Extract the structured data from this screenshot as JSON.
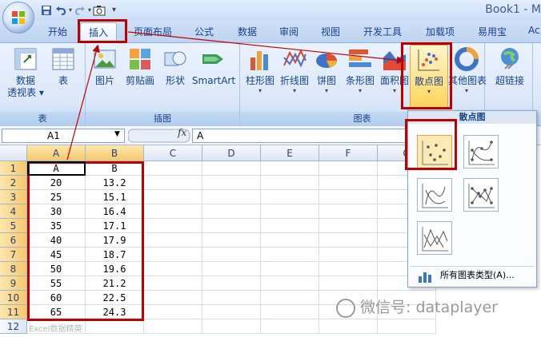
{
  "app_title": "Book1 - M",
  "tabs": [
    {
      "label": "开始"
    },
    {
      "label": "插入",
      "active": true
    },
    {
      "label": "页面布局"
    },
    {
      "label": "公式"
    },
    {
      "label": "数据"
    },
    {
      "label": "审阅"
    },
    {
      "label": "视图"
    },
    {
      "label": "开发工具"
    },
    {
      "label": "加载项"
    },
    {
      "label": "易用宝"
    },
    {
      "label": "Ac"
    }
  ],
  "ribbon": {
    "groups": [
      {
        "label": "表",
        "buttons": [
          {
            "label": "数据",
            "label2": "透视表 ▾",
            "icon": "pivot-table-icon"
          },
          {
            "label": "表",
            "icon": "table-icon"
          }
        ]
      },
      {
        "label": "插图",
        "buttons": [
          {
            "label": "图片",
            "icon": "picture-icon"
          },
          {
            "label": "剪贴画",
            "icon": "clipart-icon"
          },
          {
            "label": "形状",
            "icon": "shapes-icon"
          },
          {
            "label": "SmartArt",
            "icon": "smartart-icon"
          }
        ]
      },
      {
        "label": "图表",
        "buttons": [
          {
            "label": "柱形图",
            "icon": "column-chart-icon"
          },
          {
            "label": "折线图",
            "icon": "line-chart-icon"
          },
          {
            "label": "饼图",
            "icon": "pie-chart-icon"
          },
          {
            "label": "条形图",
            "icon": "bar-chart-icon"
          },
          {
            "label": "面积图",
            "icon": "area-chart-icon"
          },
          {
            "label": "散点图",
            "icon": "scatter-chart-icon"
          },
          {
            "label": "其他图表",
            "icon": "other-charts-icon"
          }
        ]
      },
      {
        "label": "",
        "buttons": [
          {
            "label": "超链接",
            "icon": "hyperlink-icon"
          }
        ]
      }
    ]
  },
  "formula_bar": {
    "name_box": "A1",
    "fx": "fx",
    "value": "A"
  },
  "sheet": {
    "columns": [
      "A",
      "B",
      "C",
      "D",
      "E",
      "F",
      "G"
    ],
    "rows": [
      {
        "num": "1",
        "a": "A",
        "b": "B"
      },
      {
        "num": "2",
        "a": "20",
        "b": "13.2"
      },
      {
        "num": "3",
        "a": "25",
        "b": "15.1"
      },
      {
        "num": "4",
        "a": "30",
        "b": "16.4"
      },
      {
        "num": "5",
        "a": "35",
        "b": "17.1"
      },
      {
        "num": "6",
        "a": "40",
        "b": "17.9"
      },
      {
        "num": "7",
        "a": "45",
        "b": "18.7"
      },
      {
        "num": "8",
        "a": "50",
        "b": "19.6"
      },
      {
        "num": "9",
        "a": "55",
        "b": "21.2"
      },
      {
        "num": "10",
        "a": "60",
        "b": "22.5"
      },
      {
        "num": "11",
        "a": "65",
        "b": "24.3"
      },
      {
        "num": "12",
        "a": "",
        "b": ""
      }
    ]
  },
  "dropdown": {
    "header": "散点图",
    "subtypes": [
      "scatter-markers-only",
      "scatter-smooth-lines-markers",
      "scatter-smooth-lines",
      "scatter-straight-lines-markers",
      "scatter-straight-lines"
    ],
    "all_types_label": "所有图表类型(A)..."
  },
  "watermark": "微信号: dataplayer",
  "corner_stamp": "Excel数据精英"
}
